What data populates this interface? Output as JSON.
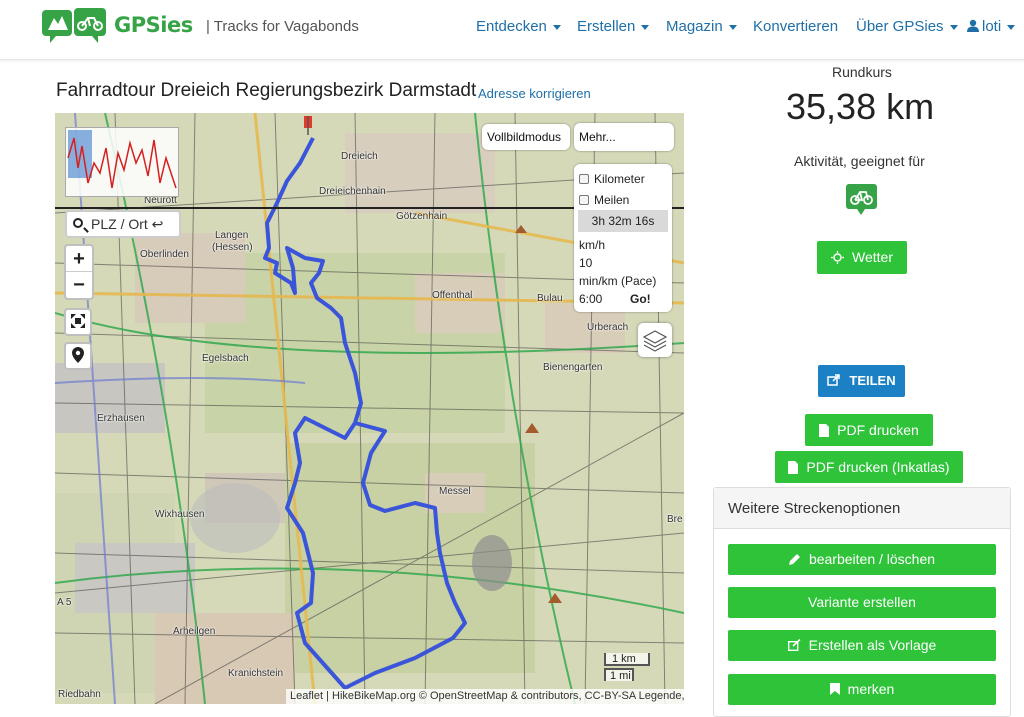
{
  "header": {
    "logo_text": "GPSies",
    "tagline": "| Tracks for Vagabonds",
    "nav": [
      {
        "label": "Entdecken",
        "dropdown": true
      },
      {
        "label": "Erstellen",
        "dropdown": true
      },
      {
        "label": "Magazin",
        "dropdown": true
      },
      {
        "label": "Konvertieren",
        "dropdown": false
      },
      {
        "label": "Über GPSies",
        "dropdown": true
      },
      {
        "label": "loti",
        "dropdown": true
      }
    ]
  },
  "page": {
    "title": "Fahrradtour Dreieich Regierungsbezirk Darmstadt",
    "fix_address": "Adresse korrigieren"
  },
  "map": {
    "fullscreen_label": "Vollbildmodus",
    "more_label": "Mehr...",
    "search_placeholder": "PLZ / Ort ↩",
    "zoom_in": "+",
    "zoom_out": "−",
    "pace": {
      "kilometer": "Kilometer",
      "meilen": "Meilen",
      "time": "3h 32m 16s",
      "kmh_label": "km/h",
      "kmh_value": "10",
      "pace_label": "min/km (Pace)",
      "pace_value": "6:00",
      "go": "Go!"
    },
    "scale": {
      "km": "1 km",
      "mi": "1 mi"
    },
    "attribution": "Leaflet | HikeBikeMap.org © OpenStreetMap & contributors, CC-BY-SA Legende,",
    "labels": {
      "neurott": "Neurott",
      "dreieich": "Dreieich",
      "dreieichenhain": "Dreieichenhain",
      "goetzenhain": "Götzenhain",
      "langen": "Langen",
      "hessen": "(Hessen)",
      "oberlinden": "Oberlinden",
      "offenthal": "Offenthal",
      "bulau": "Bulau",
      "urberach": "Urberach",
      "egelsbach": "Egelsbach",
      "bienengarten": "Bienengarten",
      "erzhausen": "Erzhausen",
      "messel": "Messel",
      "wixhausen": "Wixhausen",
      "arheilgen": "Arheilgen",
      "kranichstein": "Kranichstein",
      "riedbahn": "Riedbahn",
      "a5": "A 5",
      "bre": "Bre"
    }
  },
  "sidebar": {
    "rundkurs": "Rundkurs",
    "distance": "35,38 km",
    "activity": "Aktivität, geeignet für",
    "weather_button": "Wetter",
    "share_button": "TEILEN",
    "pdf_button": "PDF drucken",
    "pdf_atlas_button": "PDF drucken (Inkatlas)",
    "options_title": "Weitere Streckenoptionen",
    "options": [
      "bearbeiten / löschen",
      "Variante erstellen",
      "Erstellen als Vorlage",
      "merken"
    ]
  },
  "colors": {
    "brand_green": "#36a346",
    "button_green": "#2ec339",
    "share_blue": "#1b80c4",
    "link_blue": "#1f6fa8",
    "track_blue": "#3a55d9"
  },
  "icons": {
    "logo": "gps-bike-logo-icon",
    "user": "user-icon",
    "weather": "sun-icon",
    "share": "share-icon",
    "pdf": "document-icon",
    "edit": "pencil-icon",
    "template": "edit-template-icon",
    "bookmark": "bookmark-icon",
    "search": "search-icon",
    "locate": "map-pin-icon",
    "fit": "fit-bounds-icon",
    "layers": "layers-icon",
    "activity": "bicycle-icon"
  }
}
